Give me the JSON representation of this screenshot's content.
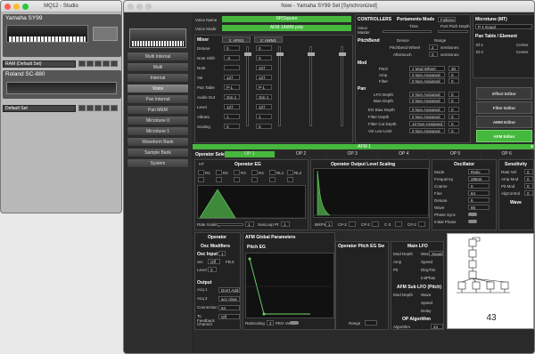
{
  "studio": {
    "title": "MQ12 - Studio",
    "devices": [
      {
        "name": "Yamaha SY99",
        "bank": "RAM (Default Set)"
      },
      {
        "name": "Roland SC-880",
        "bank": "Default Set"
      }
    ]
  },
  "editor": {
    "title": "New - Yamaha SY99 Set [Synchronized]",
    "voice_name_label": "Voice Name",
    "voice_name_value": "SP|Square",
    "voice_mode_label": "Voice Mode",
    "voice_mode_value": "AFM 1AWM poly",
    "nav": [
      "Multi Internal",
      "Multi",
      "Internal",
      "Voice",
      "Pan Internal",
      "Pan MEM",
      "Microtune 0",
      "Microtune 1",
      "Waveform Bank",
      "Sample Bank",
      "System"
    ],
    "nav_active": "Voice",
    "mixer": {
      "title": "Mixer",
      "ch1": "1: AFM1",
      "ch2": "2: AWM1",
      "rows": [
        "Detune",
        "Note Shift",
        "Note",
        "Vel",
        "Pan Table",
        "Audio Out",
        "Level",
        "Vibrato",
        "Scaling"
      ],
      "vals1": [
        "0",
        "-3",
        "",
        "127",
        "P-1",
        "Grp 1",
        "127",
        "1",
        "0"
      ],
      "vals2": [
        "0",
        "0",
        "127",
        "127",
        "P-1",
        "Grp 1",
        "127",
        "1",
        "0"
      ],
      "grp_labels": [
        "Grp 1",
        "Grp 2"
      ]
    },
    "controllers": {
      "title": "CONTROLLERS",
      "portamento_title": "Portamento Mode",
      "portamento_value": "Fulltime",
      "time_label": "Time",
      "pitch_depth_label": "Port Pitch Depth",
      "voice_master_label": "Voice Master",
      "pitchbend_label": "PitchBend",
      "device_label": "Device",
      "range_label": "Range",
      "pitchbend_wheel": "Pitchbend Wheel",
      "pitchbend_range": "2",
      "pitchbend_unit": "semitones",
      "aftertouch_label": "Aftertouch",
      "aftertouch_range": "0",
      "aftertouch_unit": "semitones",
      "mod_label": "Mod",
      "mod_rows": [
        {
          "label": "Pitch",
          "src": "1 Mod Wheel",
          "val": "30"
        },
        {
          "label": "Amp",
          "src": "0 Non Assigned",
          "val": "0"
        },
        {
          "label": "Filter",
          "src": "0 Non Assigned",
          "val": "0"
        }
      ],
      "pan_label": "Pan",
      "pan_rows": [
        {
          "label": "LFO Depth",
          "src": "0 Non Assigned",
          "val": "0"
        },
        {
          "label": "Bias Depth",
          "src": "0 Non Assigned",
          "val": "0"
        }
      ],
      "bias_rows": [
        {
          "label": "EG Bias Depth",
          "src": "0 Non Assigned",
          "val": "0"
        },
        {
          "label": "Filter Depth",
          "src": "0 Non Assigned",
          "val": "0"
        },
        {
          "label": "Filter Cut Depth",
          "src": "13 Non Assigned",
          "val": "0"
        },
        {
          "label": "Vol Low Limit",
          "src": "0 Non Assigned",
          "val": "0"
        }
      ]
    },
    "microtune": {
      "title": "Microtune (MT)",
      "p1_label": "P-1 Equal",
      "pan_table_title": "Pan Table / Element",
      "rows": [
        {
          "el": "El-1",
          "v": "Center"
        },
        {
          "el": "El-2",
          "v": "Center"
        }
      ]
    },
    "side_buttons": [
      "Effect Editor",
      "Filter Editor",
      "AWM Editor",
      "AFM Editor"
    ],
    "afm_bar": "AFM 1",
    "operator_select_label": "Operator Select",
    "op_tabs": [
      "OP 1",
      "OP 2",
      "OP 3",
      "OP 4",
      "OP 5",
      "OP 6"
    ],
    "op_eg": {
      "title": "Operator EG",
      "ht_label": "HT",
      "rate_labels": [
        "R1",
        "R2",
        "R3",
        "R4",
        "RL1",
        "RL2"
      ],
      "rate_scaling_label": "Rate Scaling",
      "rate_scaling_value": "1",
      "sustain_loop_label": "SusLoop Pt",
      "sustain_loop_value": "1"
    },
    "op_level_scaling": {
      "title": "Operator Output Level Scaling",
      "bk_labels": [
        "BrkPnt",
        "C#-2",
        "C#-2",
        "C-3",
        "C#-2"
      ],
      "bk_values": [
        "1",
        "",
        "",
        "",
        ""
      ]
    },
    "oscillator": {
      "title": "Oscillator",
      "mode_label": "Mode",
      "mode_value": "Ratio",
      "freq_label": "Frequency",
      "freq_value": "28844",
      "coarse_label": "Coarse",
      "coarse_value": "0",
      "fine_label": "Fine",
      "fine_value": "64",
      "detune_label": "Detune",
      "detune_value": "6",
      "wave_label": "Wave",
      "wave_value": "66",
      "phase_sync_label": "Phase Sync",
      "initial_phase_label": "Initial Phase"
    },
    "sensitivity": {
      "title": "Sensitivity",
      "rows": [
        {
          "label": "Rate Vel",
          "val": "0"
        },
        {
          "label": "Amp Mod",
          "val": "0"
        },
        {
          "label": "Pit Mod",
          "val": "0"
        },
        {
          "label": "AlgControl",
          "val": "0"
        }
      ],
      "wave_label": "Wave"
    },
    "operator": {
      "title": "Operator",
      "osc_modifiers": "Osc Modifiers",
      "osc_input_label": "Osc Input",
      "osc_input_value": "1",
      "src_label": "Src",
      "src_value": "Off",
      "fb_label": "FB.0",
      "level_label": "Level",
      "level_value": "0",
      "output_label": "Output",
      "rows": [
        {
          "label": "Acq 1",
          "val": "Don't Add"
        },
        {
          "label": "Acq 2",
          "val": "acc clear"
        },
        {
          "label": "Connection",
          "val": "64"
        },
        {
          "label": "To Feedback Channel",
          "val": "Off"
        }
      ]
    },
    "afm_global": {
      "title": "AFM Global Parameters",
      "pitch_eg_title": "Pitch EG",
      "op_pitch_eg_title": "Operator Pitch EG Sw",
      "rate_scaling_label": "RatScaling",
      "rate_scaling_value": "2",
      "peg_vel_label": "PEG Vel",
      "range_label": "Range"
    },
    "main_lfo": {
      "title": "Main LFO",
      "mod_depth": "Mod Depth",
      "wave_label": "Wave",
      "wave_value": "Square",
      "amp_label": "Amp",
      "speed_label": "Speed",
      "pitch_label": "Pit",
      "delay_label": "DlayTim",
      "phase_label": "InitPhas",
      "sub_title": "AFM Sub LFO (Pitch)",
      "sub_wave_value": "",
      "sub_speed_label": "Speed",
      "sub_delay_label": "Delay"
    },
    "op_algorithm": {
      "title": "OP Algorithm",
      "label": "Algorithm",
      "value": "43"
    },
    "algo_display": "43"
  }
}
